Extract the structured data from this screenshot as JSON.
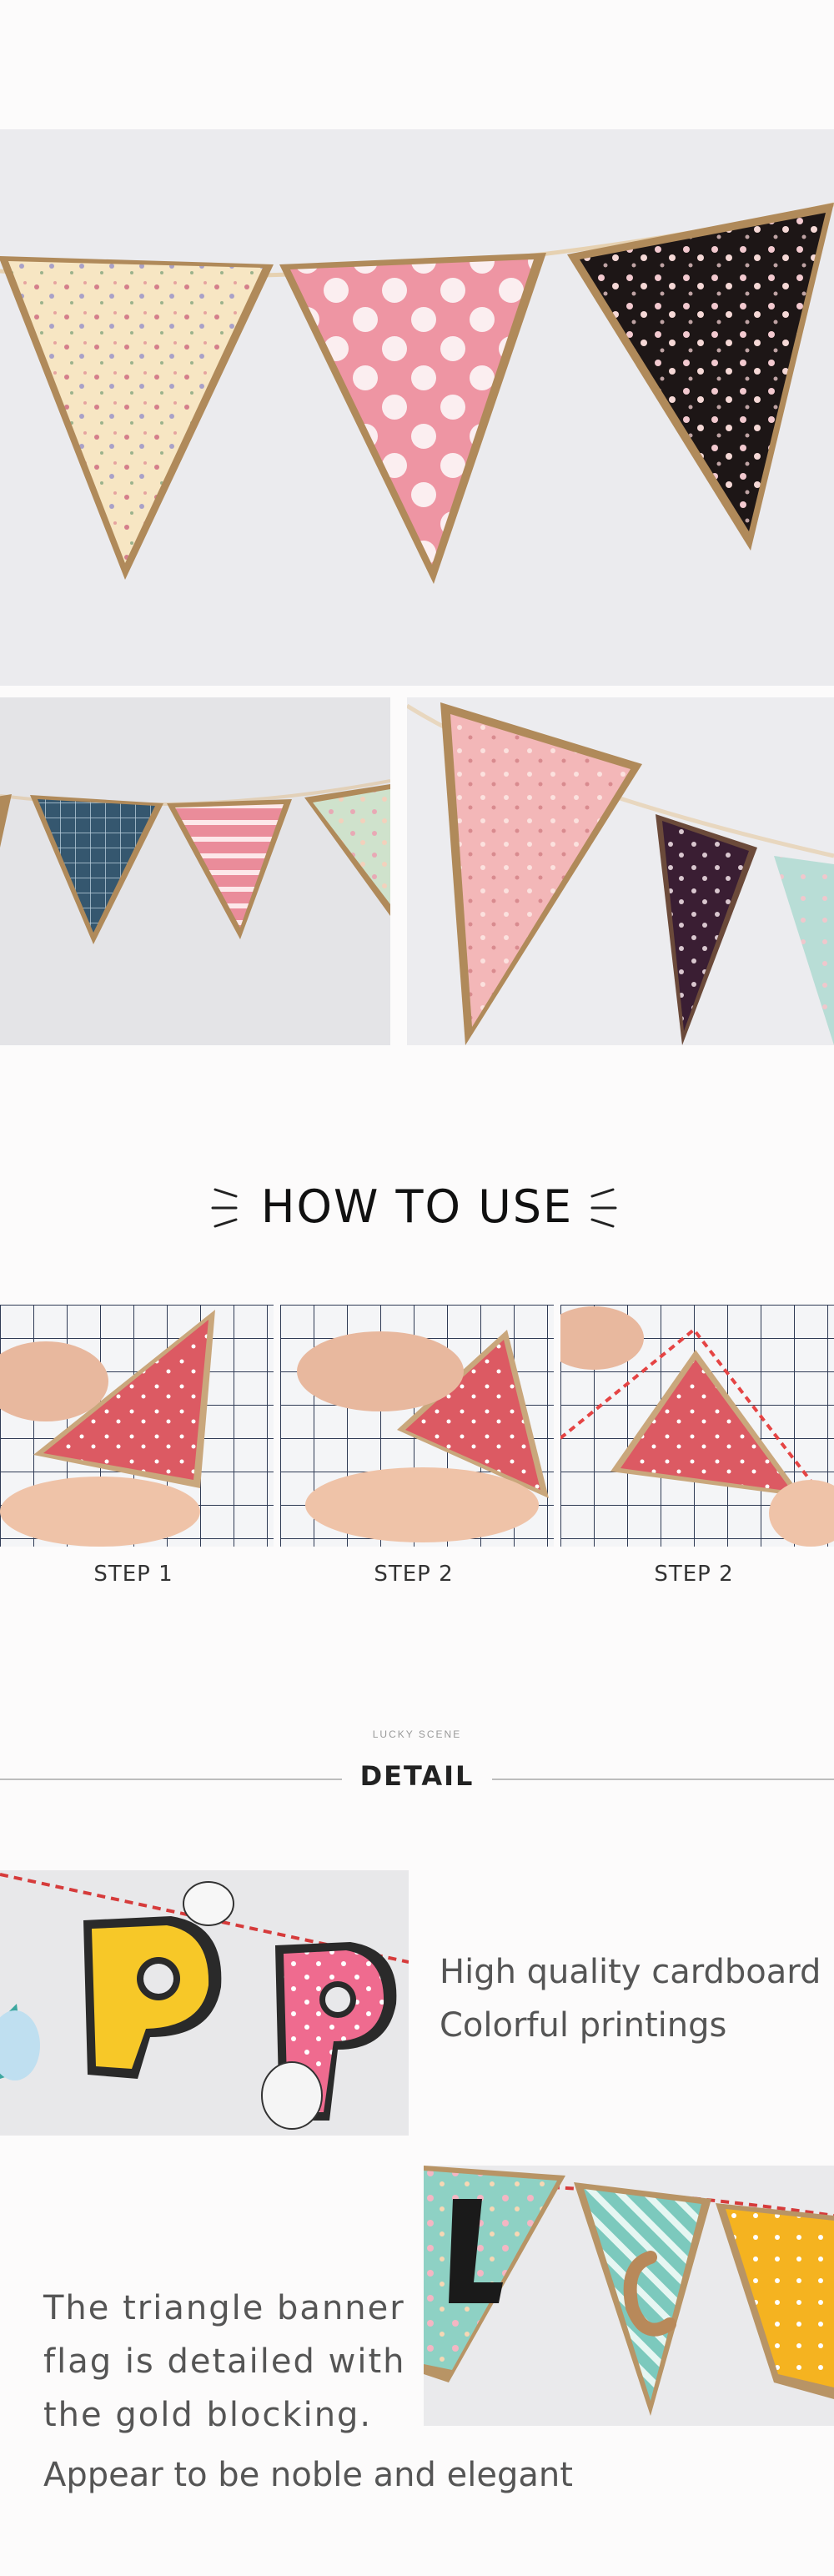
{
  "howto": {
    "title": "HOW TO USE"
  },
  "steps": [
    {
      "label": "STEP 1"
    },
    {
      "label": "STEP 2"
    },
    {
      "label": "STEP 2"
    }
  ],
  "detail": {
    "small": "LUCKY SCENE",
    "title": "DETAIL",
    "desc1": [
      "High quality cardboard",
      "Colorful printings"
    ],
    "desc2": [
      "The triangle banner",
      "flag is detailed with",
      "the gold blocking."
    ],
    "desc3": "Appear to be noble and elegant"
  }
}
